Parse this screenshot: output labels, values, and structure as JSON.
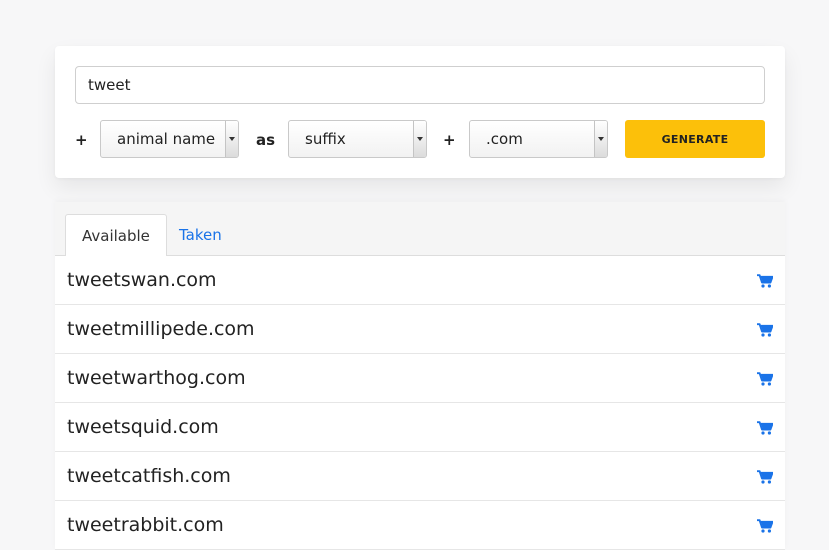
{
  "search": {
    "value": "tweet"
  },
  "builder": {
    "plus1": "+",
    "category": "animal name",
    "as": "as",
    "position": "suffix",
    "plus2": "+",
    "tld": ".com",
    "generate_label": "Generate"
  },
  "tabs": {
    "available": "Available",
    "taken": "Taken"
  },
  "results": [
    {
      "domain": "tweetswan.com"
    },
    {
      "domain": "tweetmillipede.com"
    },
    {
      "domain": "tweetwarthog.com"
    },
    {
      "domain": "tweetsquid.com"
    },
    {
      "domain": "tweetcatfish.com"
    },
    {
      "domain": "tweetrabbit.com"
    }
  ],
  "icons": {
    "row_action": "cart-icon"
  },
  "colors": {
    "accent": "#fcc00a",
    "link": "#1a73e8"
  }
}
